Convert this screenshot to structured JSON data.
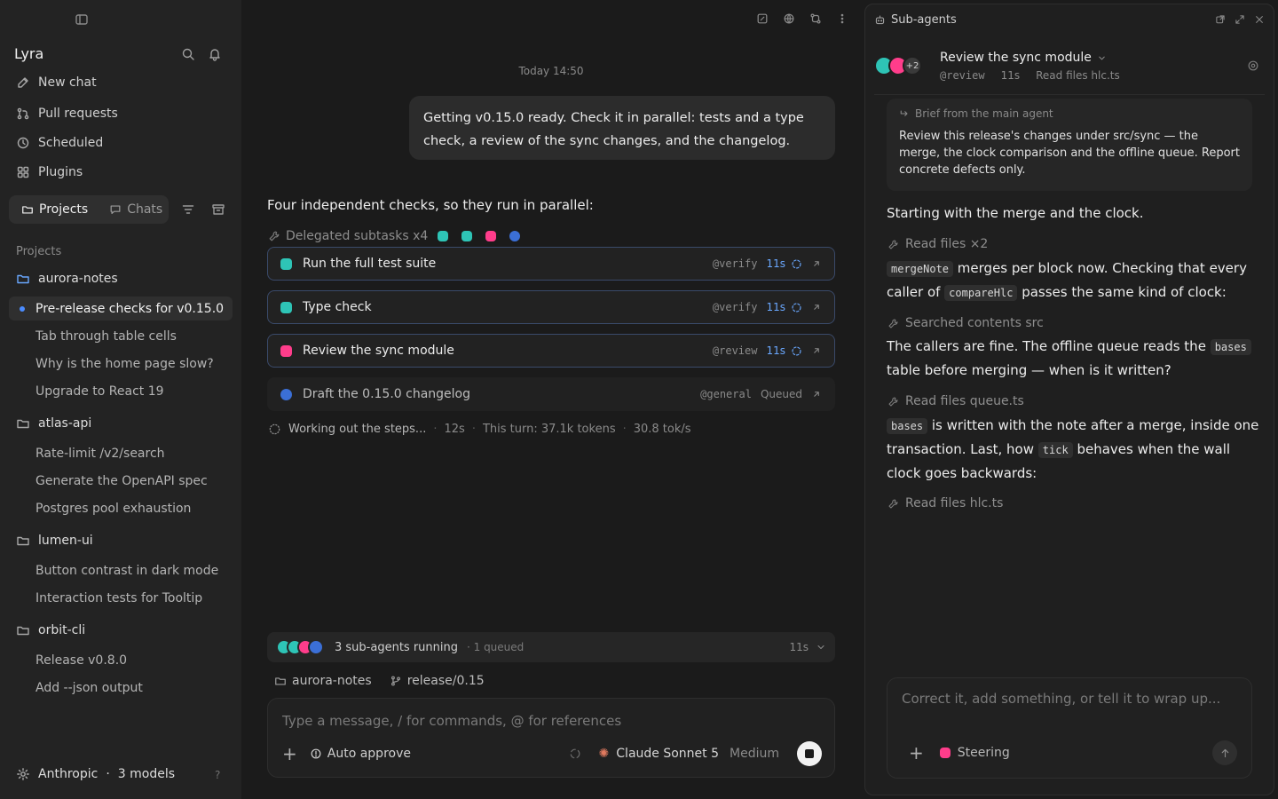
{
  "colors": {
    "teal": "#2ec4b6",
    "pink": "#ff3d8b",
    "blue": "#3b6fd6",
    "accent": "#4b8cff"
  },
  "sidebar": {
    "title": "Lyra",
    "nav": [
      {
        "label": "New chat",
        "icon": "edit-icon"
      },
      {
        "label": "Pull requests",
        "icon": "git-pull-icon"
      },
      {
        "label": "Scheduled",
        "icon": "clock-icon"
      },
      {
        "label": "Plugins",
        "icon": "grid-icon"
      }
    ],
    "segment": {
      "projects": "Projects",
      "chats": "Chats"
    },
    "section_label": "Projects",
    "projects": [
      {
        "name": "aurora-notes",
        "chats": [
          "Pre-release checks for v0.15.0",
          "Tab through table cells",
          "Why is the home page slow?",
          "Upgrade to React 19"
        ]
      },
      {
        "name": "atlas-api",
        "chats": [
          "Rate-limit /v2/search",
          "Generate the OpenAPI spec",
          "Postgres pool exhaustion"
        ]
      },
      {
        "name": "lumen-ui",
        "chats": [
          "Button contrast in dark mode",
          "Interaction tests for Tooltip"
        ]
      },
      {
        "name": "orbit-cli",
        "chats": [
          "Release v0.8.0",
          "Add --json output"
        ]
      }
    ],
    "footer": {
      "provider": "Anthropic",
      "sep": "·",
      "models": "3 models",
      "help": "?"
    }
  },
  "main": {
    "timestamp": "Today 14:50",
    "user_message": "Getting v0.15.0 ready. Check it in parallel: tests and a type check, a review of the sync changes, and the changelog.",
    "assistant_intro": "Four independent checks, so they run in parallel:",
    "delegated_label": "Delegated subtasks x4",
    "tasks": [
      {
        "label": "Run the full test suite",
        "handle": "@verify",
        "time": "11s",
        "status": "",
        "color": "#2ec4b6"
      },
      {
        "label": "Type check",
        "handle": "@verify",
        "time": "11s",
        "status": "",
        "color": "#2ec4b6"
      },
      {
        "label": "Review the sync module",
        "handle": "@review",
        "time": "11s",
        "status": "",
        "color": "#ff3d8b"
      },
      {
        "label": "Draft the 0.15.0 changelog",
        "handle": "@general",
        "time": "",
        "status": "Queued",
        "color": "#3b6fd6"
      }
    ],
    "working": {
      "text": "Working out the steps...",
      "elapsed": "12s",
      "tokens": "This turn: 37.1k tokens",
      "rate": "30.8 tok/s",
      "sep": "·"
    },
    "subagents_bar": {
      "running": "3 sub-agents running",
      "queued": "· 1 queued",
      "time": "11s"
    },
    "context": {
      "project": "aurora-notes",
      "branch": "release/0.15"
    },
    "composer": {
      "placeholder": "Type a message, / for commands, @ for references",
      "approve": "Auto approve",
      "model": "Claude Sonnet 5",
      "effort": "Medium"
    }
  },
  "panel": {
    "title": "Sub-agents",
    "agent": {
      "title": "Review the sync module",
      "handle": "@review",
      "time": "11s",
      "activity": "Read files hlc.ts",
      "extra": "+2"
    },
    "brief": {
      "header": "Brief from the main agent",
      "body": "Review this release's changes under src/sync — the merge, the clock comparison and the offline queue. Report concrete defects only."
    },
    "steps": {
      "t1": "Starting with the merge and the clock.",
      "tool1": "Read files ×2",
      "t2": {
        "code1": "mergeNote",
        "a": " merges per block now. Checking that every caller of ",
        "code2": "compareHlc",
        "b": " passes the same kind of clock:"
      },
      "tool2": "Searched contents src",
      "t3": {
        "a": "The callers are fine. The offline queue reads the ",
        "code": "bases",
        "b": " table before merging — when is it written?"
      },
      "tool3": "Read files queue.ts",
      "t4": {
        "code1": "bases",
        "a": " is written with the note after a merge, inside one transaction. Last, how ",
        "code2": "tick",
        "b": " behaves when the wall clock goes backwards:"
      },
      "tool4": "Read files hlc.ts"
    },
    "composer": {
      "placeholder": "Correct it, add something, or tell it to wrap up...",
      "steering": "Steering"
    }
  }
}
